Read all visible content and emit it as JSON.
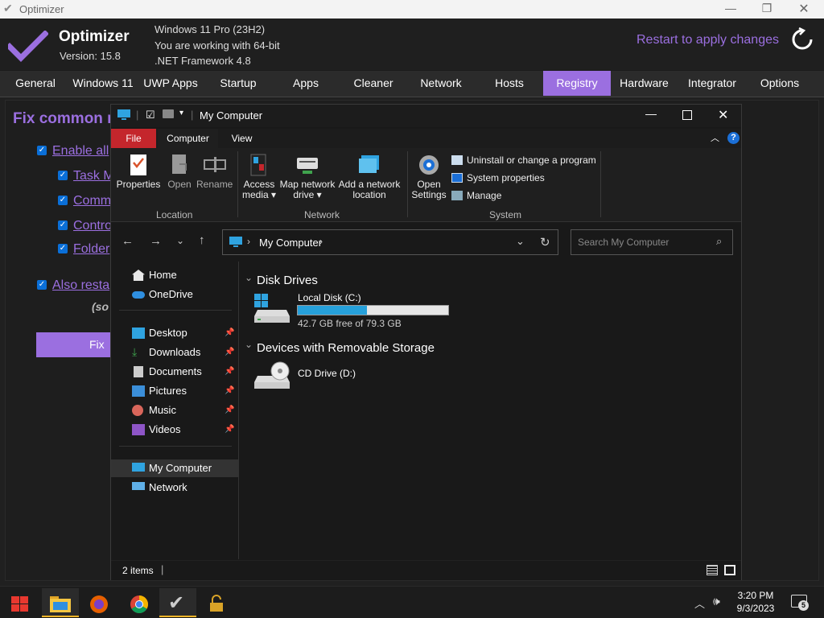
{
  "optimizer": {
    "window_title": "Optimizer",
    "app_name": "Optimizer",
    "version": "Version: 15.8",
    "sysinfo": [
      "Windows 11 Pro (23H2)",
      "You are working with 64-bit",
      ".NET Framework 4.8"
    ],
    "restart_label": "Restart to apply changes",
    "tabs": [
      "General",
      "Windows 11",
      "UWP Apps",
      "Startup",
      "Apps",
      "Cleaner",
      "Network",
      "Hosts",
      "Registry",
      "Hardware",
      "Integrator",
      "Options"
    ],
    "active_tab": "Registry",
    "panel_title": "Fix common r",
    "options": [
      {
        "label": "Enable all",
        "checked": true
      },
      {
        "label": "Task M",
        "checked": true
      },
      {
        "label": "Comm",
        "checked": true
      },
      {
        "label": "Contro",
        "checked": true
      },
      {
        "label": "Folder",
        "checked": true
      },
      {
        "label": "Also resta",
        "checked": true
      }
    ],
    "note": "(so",
    "fix_label": "Fix",
    "accent": "#9b6fe0"
  },
  "explorer": {
    "title": "My Computer",
    "ribbon_tabs": [
      "File",
      "Computer",
      "View"
    ],
    "ribbon": {
      "properties": "Properties",
      "open": "Open",
      "rename": "Rename",
      "access_media_1": "Access",
      "access_media_2": "media",
      "map_drive_1": "Map network",
      "map_drive_2": "drive",
      "add_location_1": "Add a network",
      "add_location_2": "location",
      "open_settings_1": "Open",
      "open_settings_2": "Settings",
      "uninstall": "Uninstall or change a program",
      "system_properties": "System properties",
      "manage": "Manage",
      "group_location": "Location",
      "group_network": "Network",
      "group_system": "System"
    },
    "address": "My Computer",
    "search_placeholder": "Search My Computer",
    "sidebar": {
      "home": "Home",
      "onedrive": "OneDrive",
      "desktop": "Desktop",
      "downloads": "Downloads",
      "documents": "Documents",
      "pictures": "Pictures",
      "music": "Music",
      "videos": "Videos",
      "mycomputer": "My Computer",
      "network": "Network"
    },
    "groups": {
      "disk_drives": "Disk Drives",
      "removable": "Devices with Removable Storage"
    },
    "local_disk": {
      "name": "Local Disk (C:)",
      "free_text": "42.7 GB free of 79.3 GB",
      "used_fraction": 0.46
    },
    "cd_drive": {
      "name": "CD Drive (D:)"
    },
    "status": "2 items"
  },
  "taskbar": {
    "time": "3:20 PM",
    "date": "9/3/2023",
    "notifications": "5"
  }
}
